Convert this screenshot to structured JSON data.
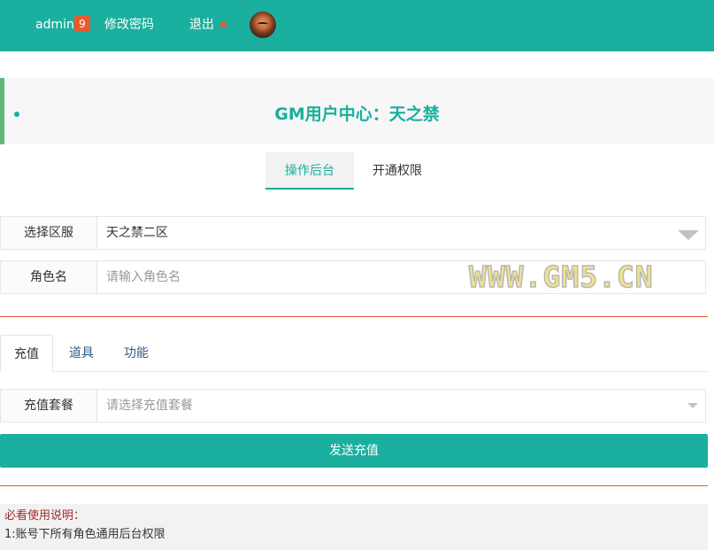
{
  "header": {
    "username": "admin",
    "badge_count": "9",
    "change_password": "修改密码",
    "logout": "退出",
    "brand_color": "#1aaf9e",
    "badge_color": "#ea5a2f"
  },
  "page_title": "GM用户中心：天之禁",
  "main_tabs": [
    {
      "label": "操作后台",
      "active": true
    },
    {
      "label": "开通权限",
      "active": false
    }
  ],
  "server_select": {
    "label": "选择区服",
    "value": "天之禁二区"
  },
  "role_input": {
    "label": "角色名",
    "placeholder": "请输入角色名"
  },
  "watermark": "WWW.GM5.CN",
  "action_tabs": [
    {
      "label": "充值",
      "active": true
    },
    {
      "label": "道具",
      "active": false
    },
    {
      "label": "功能",
      "active": false
    }
  ],
  "package_select": {
    "label": "充值套餐",
    "placeholder": "请选择充值套餐"
  },
  "send_button": "发送充值",
  "notes": {
    "title": "必看使用说明：",
    "lines": [
      "1:账号下所有角色通用后台权限"
    ]
  }
}
